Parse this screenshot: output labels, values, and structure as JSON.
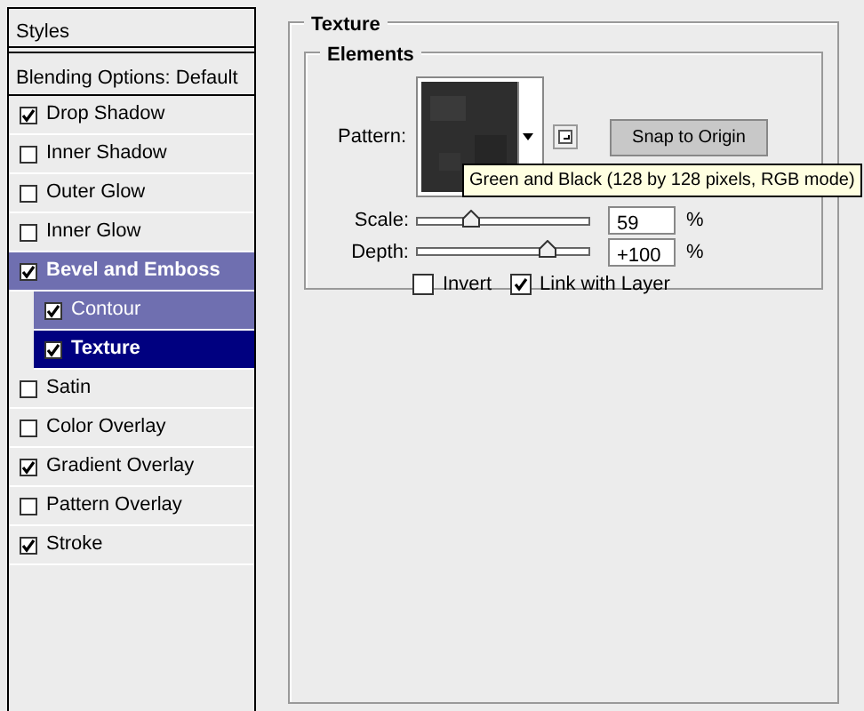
{
  "styles_panel": {
    "header": "Styles",
    "blending_options": "Blending Options: Default",
    "items": [
      {
        "label": "Drop Shadow",
        "checked": true,
        "selected": false,
        "highlighted": false
      },
      {
        "label": "Inner Shadow",
        "checked": false,
        "selected": false,
        "highlighted": false
      },
      {
        "label": "Outer Glow",
        "checked": false,
        "selected": false,
        "highlighted": false
      },
      {
        "label": "Inner Glow",
        "checked": false,
        "selected": false,
        "highlighted": false
      },
      {
        "label": "Bevel and Emboss",
        "checked": true,
        "selected": false,
        "highlighted": true,
        "children": [
          {
            "label": "Contour",
            "checked": true,
            "selected": false,
            "highlighted": true
          },
          {
            "label": "Texture",
            "checked": true,
            "selected": true,
            "highlighted": false
          }
        ]
      },
      {
        "label": "Satin",
        "checked": false,
        "selected": false,
        "highlighted": false
      },
      {
        "label": "Color Overlay",
        "checked": false,
        "selected": false,
        "highlighted": false
      },
      {
        "label": "Gradient Overlay",
        "checked": true,
        "selected": false,
        "highlighted": false
      },
      {
        "label": "Pattern Overlay",
        "checked": false,
        "selected": false,
        "highlighted": false
      },
      {
        "label": "Stroke",
        "checked": true,
        "selected": false,
        "highlighted": false
      }
    ]
  },
  "texture": {
    "title": "Texture",
    "elements": {
      "title": "Elements",
      "pattern_label": "Pattern:",
      "snap_button": "Snap to Origin",
      "tooltip": "Green and Black (128 by 128 pixels, RGB mode)",
      "sliders": [
        {
          "label": "Scale:",
          "level": 0.31,
          "value": "59",
          "unit": "%"
        },
        {
          "label": "Depth:",
          "level": 0.76,
          "value": "+100",
          "unit": "%"
        }
      ],
      "options": [
        {
          "label": "Invert",
          "checked": false
        },
        {
          "label": "Link with Layer",
          "checked": true
        }
      ]
    }
  }
}
